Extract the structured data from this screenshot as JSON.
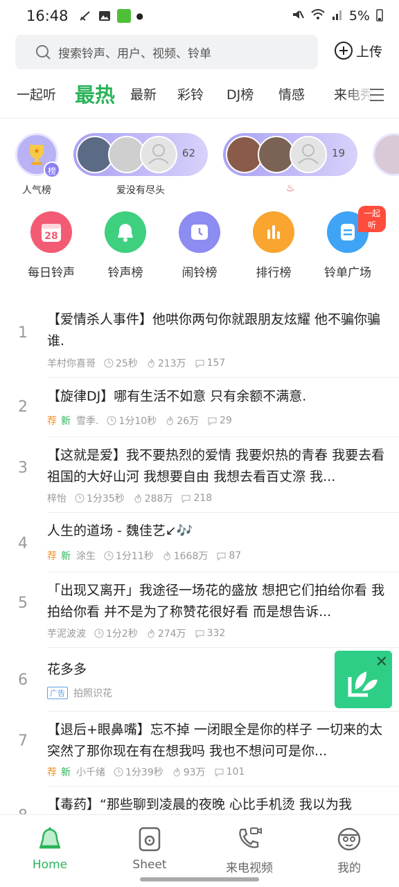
{
  "status": {
    "time": "16:48",
    "battery": "5%"
  },
  "search": {
    "placeholder": "搜索铃声、用户、视频、铃单",
    "upload_label": "上传"
  },
  "tabs": [
    "一起听",
    "最热",
    "最新",
    "彩铃",
    "DJ榜",
    "情感",
    "来电秀"
  ],
  "active_tab": "最热",
  "stories": [
    {
      "label": "人气榜",
      "badge": "榜"
    },
    {
      "label": "爱没有尽头",
      "count": "62"
    },
    {
      "label": "♨",
      "count": "19"
    }
  ],
  "grid": [
    {
      "label": "每日铃声",
      "icon": "calendar-icon",
      "icon_text": "28",
      "color": "#f25b73"
    },
    {
      "label": "铃声榜",
      "icon": "bell-icon",
      "color": "#3ecf7f"
    },
    {
      "label": "闹铃榜",
      "icon": "alarm-clock-icon",
      "color": "#8c8cf2"
    },
    {
      "label": "排行榜",
      "icon": "bar-chart-icon",
      "color": "#f9a530"
    },
    {
      "label": "铃单广场",
      "icon": "playlist-icon",
      "color": "#3fa4f5",
      "tag": "一起听"
    }
  ],
  "list": [
    {
      "num": "1",
      "title": "【爱情杀人事件】他哄你两句你就跟朋友炫耀 他不骗你骗谁.",
      "author": "羊村你喜哥",
      "duration": "25秒",
      "plays": "213万",
      "comments": "157"
    },
    {
      "num": "2",
      "title": "【旋律DJ】哪有生活不如意 只有余额不满意.",
      "rec": "荐",
      "new": "新",
      "author": "雪季.",
      "duration": "1分10秒",
      "plays": "26万",
      "comments": "29"
    },
    {
      "num": "3",
      "title": "【这就是爱】我不要热烈的爱情 我要炽热的青春 我要去看祖国的大好山河 我想要自由 我想去看百丈漈 我...",
      "author": "梓怡",
      "duration": "1分35秒",
      "plays": "288万",
      "comments": "218"
    },
    {
      "num": "4",
      "title": "人生的道场 - 魏佳艺↙🎶",
      "rec": "荐",
      "new": "新",
      "author": "涂生",
      "duration": "1分11秒",
      "plays": "1668万",
      "comments": "87"
    },
    {
      "num": "5",
      "title": "「出现又离开」我途径一场花的盛放 想把它们拍给你看 我拍给你看 并不是为了称赞花很好看 而是想告诉...",
      "author": "芋泥波波",
      "duration": "1分2秒",
      "plays": "274万",
      "comments": "332"
    },
    {
      "num": "6",
      "title": "花多多",
      "ad": "广告",
      "author": "拍照识花"
    },
    {
      "num": "7",
      "title": "【退后+眼鼻嘴】忘不掉 一闭眼全是你的样子 一切来的太突然了那你现在有在想我吗 我也不想问可是你...",
      "rec": "荐",
      "new": "新",
      "author": "小千绪",
      "duration": "1分39秒",
      "plays": "93万",
      "comments": "101"
    },
    {
      "num": "8",
      "title": "【毒药】“那些聊到凌晨的夜晚 心比手机烫 我以为我"
    }
  ],
  "nav": [
    {
      "label": "Home",
      "icon": "home-bell-icon"
    },
    {
      "label": "Sheet",
      "icon": "sheet-icon"
    },
    {
      "label": "来电视频",
      "icon": "phone-video-icon"
    },
    {
      "label": "我的",
      "icon": "profile-icon"
    }
  ],
  "colors": {
    "accent": "#2bb35a",
    "rec": "#f0922c",
    "ad_blue": "#5aa0e6"
  }
}
